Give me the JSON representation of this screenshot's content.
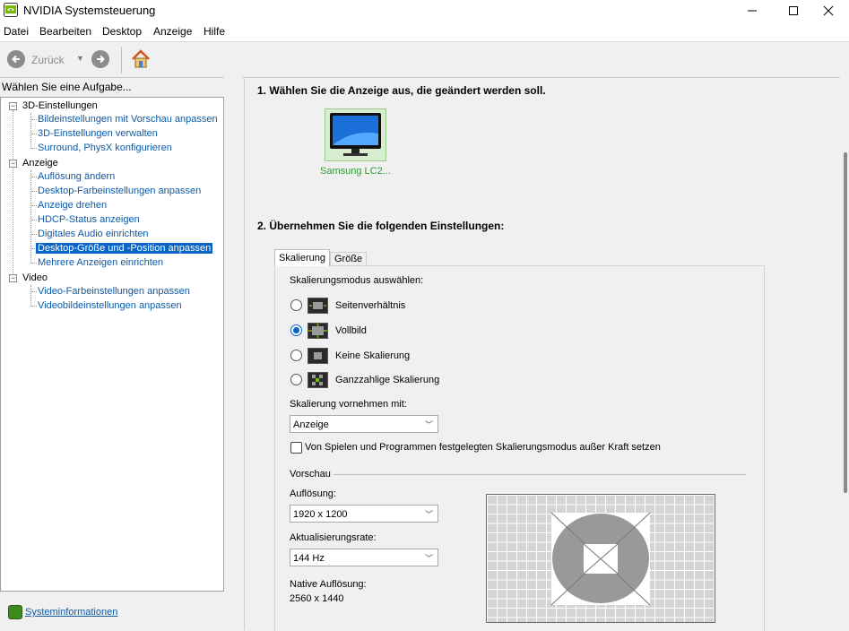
{
  "window": {
    "title": "NVIDIA Systemsteuerung"
  },
  "menu": [
    "Datei",
    "Bearbeiten",
    "Desktop",
    "Anzeige",
    "Hilfe"
  ],
  "toolbar": {
    "back_label": "Zurück"
  },
  "left_panel": {
    "header": "Wählen Sie eine Aufgabe...",
    "tree": [
      {
        "label": "3D-Einstellungen",
        "children": [
          "Bildeinstellungen mit Vorschau anpassen",
          "3D-Einstellungen verwalten",
          "Surround, PhysX konfigurieren"
        ]
      },
      {
        "label": "Anzeige",
        "children": [
          "Auflösung ändern",
          "Desktop-Farbeinstellungen anpassen",
          "Anzeige drehen",
          "HDCP-Status anzeigen",
          "Digitales Audio einrichten",
          "Desktop-Größe und -Position anpassen",
          "Mehrere Anzeigen einrichten"
        ]
      },
      {
        "label": "Video",
        "children": [
          "Video-Farbeinstellungen anpassen",
          "Videobildeinstellungen anpassen"
        ]
      }
    ],
    "selected_item": "Desktop-Größe und -Position anpassen",
    "sysinfo_link": "Systeminformationen"
  },
  "main": {
    "step1_title": "1. Wählen Sie die Anzeige aus, die geändert werden soll.",
    "display_name": "Samsung LC2...",
    "step2_title": "2. Übernehmen Sie die folgenden Einstellungen:",
    "tabs": [
      "Skalierung",
      "Größe"
    ],
    "active_tab": "Skalierung",
    "scaling_mode_label": "Skalierungsmodus auswählen:",
    "scaling_modes": [
      {
        "label": "Seitenverhältnis",
        "checked": false
      },
      {
        "label": "Vollbild",
        "checked": true
      },
      {
        "label": "Keine Skalierung",
        "checked": false
      },
      {
        "label": "Ganzzahlige Skalierung",
        "checked": false
      }
    ],
    "perform_scaling_label": "Skalierung vornehmen mit:",
    "perform_scaling_value": "Anzeige",
    "override_checkbox": {
      "label": "Von Spielen und Programmen festgelegten Skalierungsmodus außer Kraft setzen",
      "checked": false
    },
    "preview_label": "Vorschau",
    "resolution_label": "Auflösung:",
    "resolution_value": "1920 x 1200",
    "refresh_label": "Aktualisierungsrate:",
    "refresh_value": "144 Hz",
    "native_label": "Native Auflösung:",
    "native_value": "2560 x 1440"
  },
  "colors": {
    "accent": "#0a64c8",
    "link": "#0e5aa7",
    "nvidia_green": "#76b900"
  }
}
